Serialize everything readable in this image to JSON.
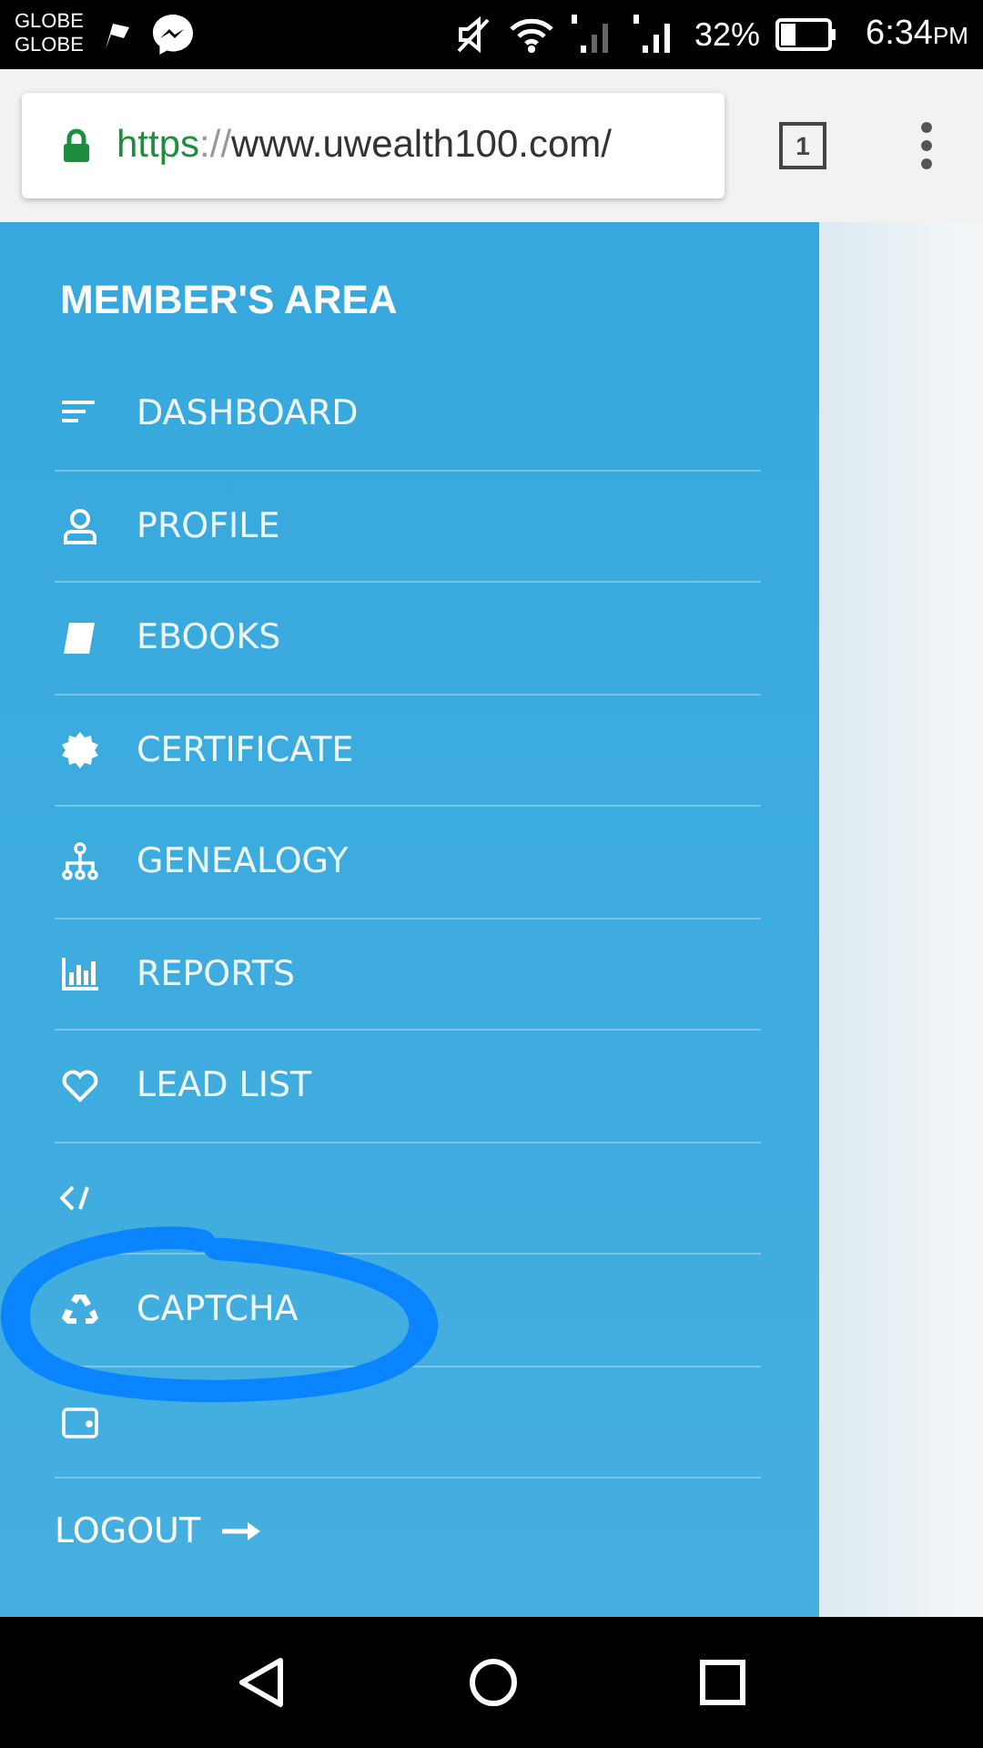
{
  "status_bar": {
    "carriers": [
      "GLOBE",
      "GLOBE"
    ],
    "battery": "32%",
    "time": "6:34",
    "ampm": "PM"
  },
  "browser": {
    "url_scheme": "https",
    "url_separator": "://",
    "url_rest": "www.uwealth100.com/",
    "tab_count": "1"
  },
  "drawer": {
    "title": "MEMBER'S AREA",
    "items": [
      {
        "kind": "lines",
        "label": "DASHBOARD"
      },
      {
        "kind": "person",
        "label": "PROFILE"
      },
      {
        "kind": "book",
        "label": "EBOOKS"
      },
      {
        "kind": "badge",
        "label": "CERTIFICATE"
      },
      {
        "kind": "tree",
        "label": "GENEALOGY"
      },
      {
        "kind": "bars",
        "label": "REPORTS"
      },
      {
        "kind": "heart",
        "label": "LEAD LIST"
      },
      {
        "kind": "code"
      },
      {
        "kind": "recycle",
        "label": "CAPTCHA"
      },
      {
        "kind": "wallet"
      }
    ],
    "logout": "LOGOUT"
  }
}
